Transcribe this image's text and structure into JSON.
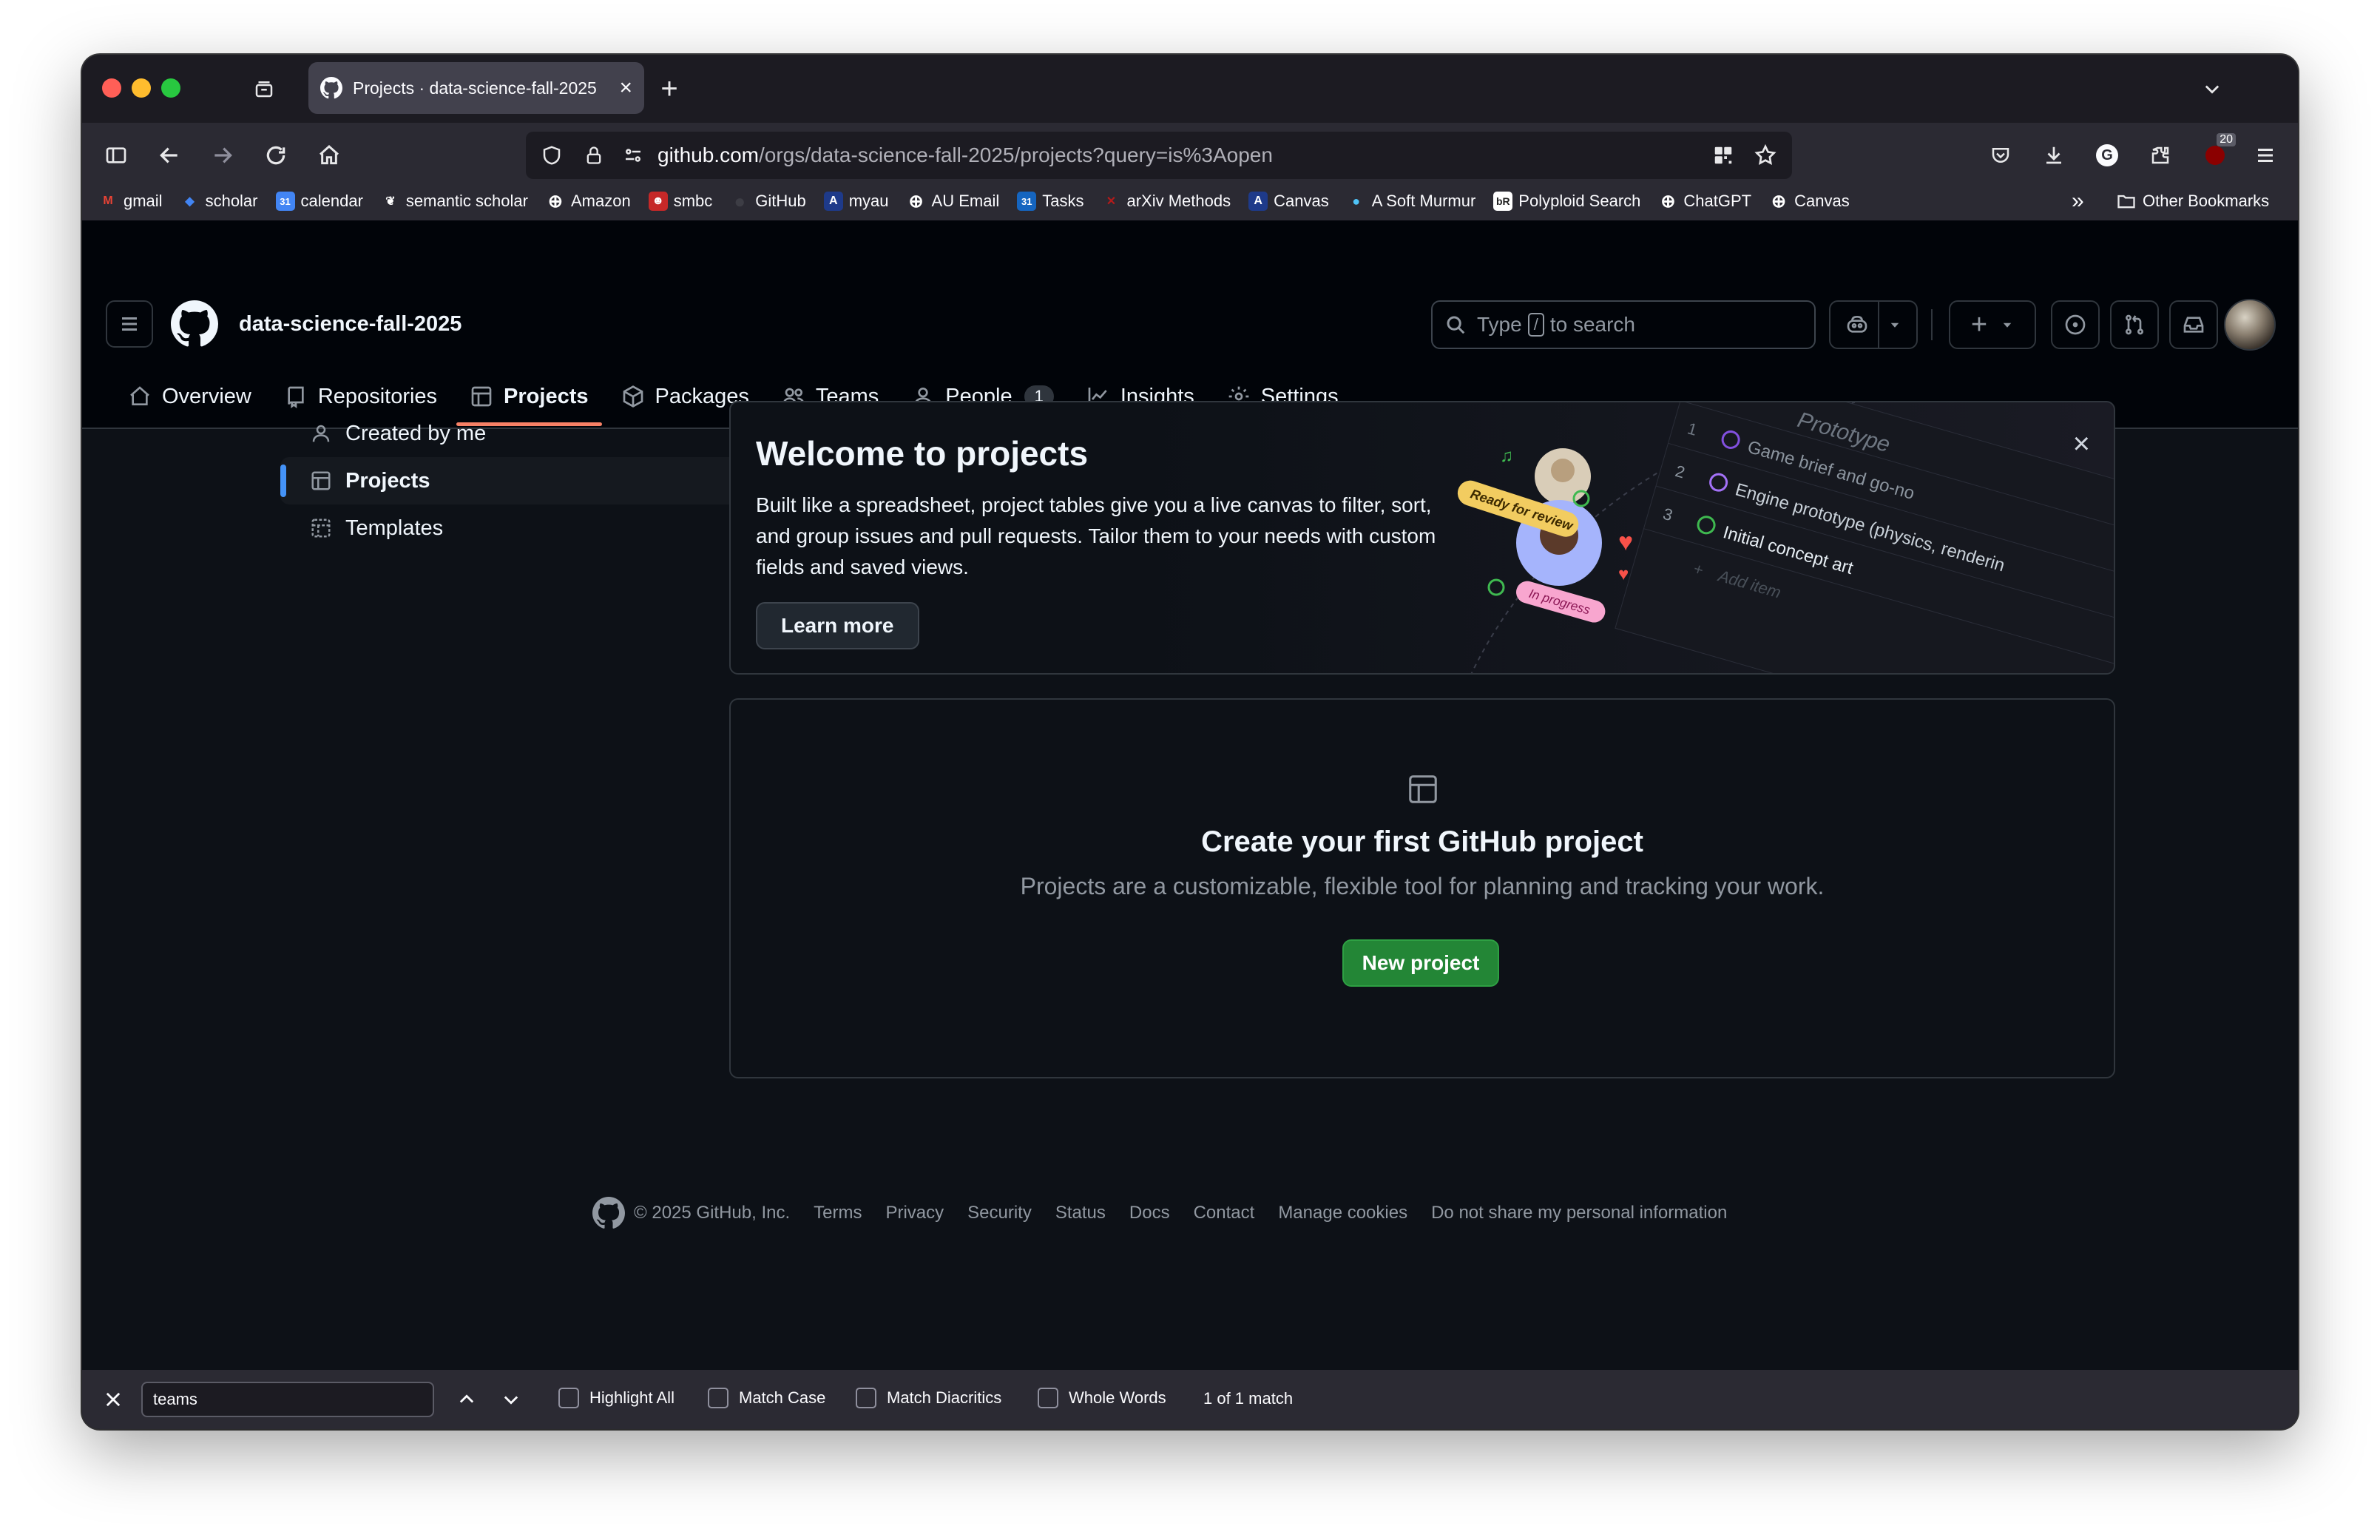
{
  "browser": {
    "tab_title": "Projects · data-science-fall-2025",
    "url_host": "github.com",
    "url_path": "/orgs/data-science-fall-2025/projects?query=is%3Aopen",
    "extension_badge": "20",
    "bookmarks": [
      {
        "label": "gmail",
        "icon": "gmail-icon",
        "color": "#ea4335",
        "glyph": "M"
      },
      {
        "label": "scholar",
        "icon": "scholar-icon",
        "color": "#4285f4",
        "glyph": "◆"
      },
      {
        "label": "calendar",
        "icon": "calendar-icon",
        "color": "#4285f4",
        "glyph": "31"
      },
      {
        "label": "semantic scholar",
        "icon": "semantic-scholar-icon",
        "color": "#2b2a33",
        "glyph": "❦"
      },
      {
        "label": "Amazon",
        "icon": "globe-icon",
        "color": "#2b2a33",
        "glyph": "⊕"
      },
      {
        "label": "smbc",
        "icon": "smbc-icon",
        "color": "#c62828",
        "glyph": "☻"
      },
      {
        "label": "GitHub",
        "icon": "github-icon",
        "color": "#2b2a33",
        "glyph": "●"
      },
      {
        "label": "myau",
        "icon": "myau-icon",
        "color": "#1e3a8a",
        "glyph": "A"
      },
      {
        "label": "AU Email",
        "icon": "globe-icon",
        "color": "#2b2a33",
        "glyph": "⊕"
      },
      {
        "label": "Tasks",
        "icon": "tasks-icon",
        "color": "#1565c0",
        "glyph": "31"
      },
      {
        "label": "arXiv Methods",
        "icon": "arxiv-icon",
        "color": "#2b2a33",
        "glyph": "✕"
      },
      {
        "label": "Canvas",
        "icon": "canvas-icon",
        "color": "#1e3a8a",
        "glyph": "A"
      },
      {
        "label": "A Soft Murmur",
        "icon": "droplet-icon",
        "color": "#2b2a33",
        "glyph": "💧"
      },
      {
        "label": "Polyploid Search",
        "icon": "polyploid-icon",
        "color": "#ffffff",
        "glyph": "bR"
      },
      {
        "label": "ChatGPT",
        "icon": "globe-icon",
        "color": "#2b2a33",
        "glyph": "⊕"
      },
      {
        "label": "Canvas",
        "icon": "globe-icon",
        "color": "#2b2a33",
        "glyph": "⊕"
      }
    ],
    "other_bookmarks": "Other Bookmarks"
  },
  "github": {
    "org_name": "data-science-fall-2025",
    "search_prefix": "Type",
    "search_key": "/",
    "search_suffix": "to search",
    "tabs": [
      {
        "label": "Overview",
        "icon": "home-icon"
      },
      {
        "label": "Repositories",
        "icon": "repo-icon"
      },
      {
        "label": "Projects",
        "icon": "table-icon"
      },
      {
        "label": "Packages",
        "icon": "package-icon"
      },
      {
        "label": "Teams",
        "icon": "people-icon"
      },
      {
        "label": "People",
        "icon": "person-icon",
        "count": "1"
      },
      {
        "label": "Insights",
        "icon": "graph-icon"
      },
      {
        "label": "Settings",
        "icon": "gear-icon"
      }
    ],
    "selected_tab": "Projects"
  },
  "sidebar": {
    "items": [
      {
        "label": "Created by me",
        "icon": "person-icon"
      },
      {
        "label": "Projects",
        "icon": "table-icon"
      },
      {
        "label": "Templates",
        "icon": "template-icon"
      }
    ],
    "active": "Projects"
  },
  "banner": {
    "title": "Welcome to projects",
    "description": "Built like a spreadsheet, project tables give you a live canvas to filter, sort, and group issues and pull requests. Tailor them to your needs with custom fields and saved views.",
    "button": "Learn more",
    "art": {
      "heading": "Prototype",
      "rows": [
        {
          "num": "1",
          "text": "Game brief and go-no"
        },
        {
          "num": "2",
          "text": "Engine prototype (physics, renderin"
        },
        {
          "num": "3",
          "text": "Initial concept art"
        }
      ],
      "add_item": "Add item",
      "ready_label": "Ready for review",
      "progress_label": "In progress"
    }
  },
  "empty_state": {
    "title": "Create your first GitHub project",
    "description": "Projects are a customizable, flexible tool for planning and tracking your work.",
    "button": "New project"
  },
  "footer": {
    "copyright": "© 2025 GitHub, Inc.",
    "links": [
      "Terms",
      "Privacy",
      "Security",
      "Status",
      "Docs",
      "Contact",
      "Manage cookies",
      "Do not share my personal information"
    ]
  },
  "findbar": {
    "query": "teams",
    "options": [
      "Highlight All",
      "Match Case",
      "Match Diacritics",
      "Whole Words"
    ],
    "status": "1 of 1 match"
  },
  "colors": {
    "accent_underline": "#f78166",
    "primary_button": "#238636",
    "active_indicator": "#4493f8"
  }
}
